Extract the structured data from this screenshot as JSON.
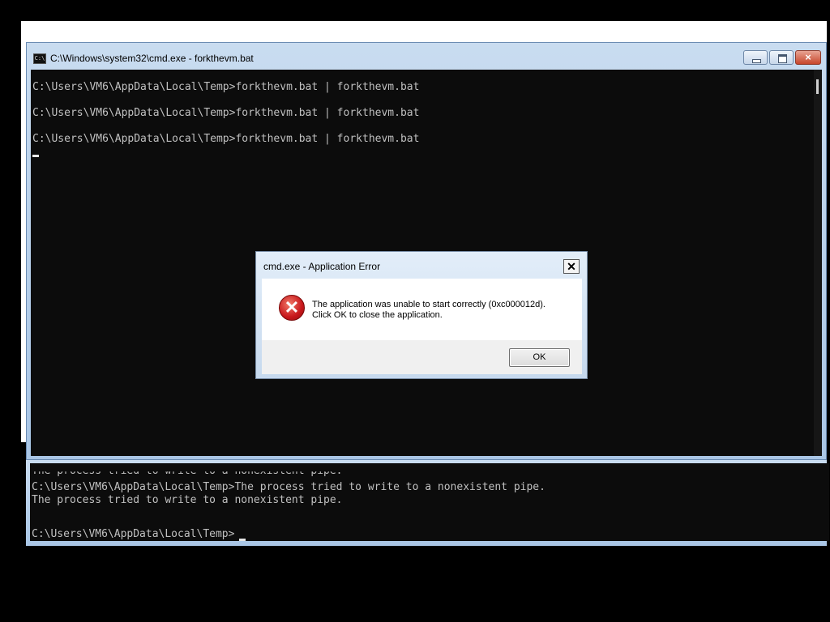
{
  "window": {
    "title": "C:\\Windows\\system32\\cmd.exe - forkthevm.bat",
    "icon": "cmd-icon",
    "icon_text": "C:\\",
    "controls": {
      "minimize": "minimize-icon",
      "maximize": "maximize-icon",
      "close": "×"
    }
  },
  "console": {
    "lines": [
      "C:\\Users\\VM6\\AppData\\Local\\Temp>forkthevm.bat | forkthevm.bat",
      "C:\\Users\\VM6\\AppData\\Local\\Temp>forkthevm.bat | forkthevm.bat",
      "C:\\Users\\VM6\\AppData\\Local\\Temp>forkthevm.bat | forkthevm.bat"
    ]
  },
  "console2": {
    "lines": [
      "The process tried to write to a nonexistent pipe.",
      "C:\\Users\\VM6\\AppData\\Local\\Temp>The process tried to write to a nonexistent pipe.",
      "The process tried to write to a nonexistent pipe.",
      "C:\\Users\\VM6\\AppData\\Local\\Temp>"
    ]
  },
  "dialog": {
    "title": "cmd.exe - Application Error",
    "close": "✕",
    "icon": "error-icon",
    "icon_glyph": "✕",
    "message_line1": "The application was unable to start correctly (0xc000012d).",
    "message_line2": "Click OK to close the application.",
    "ok_label": "OK"
  },
  "colors": {
    "console_bg": "#0c0c0c",
    "console_text": "#c0c0c0",
    "title_bar": "#b9d1ea",
    "error_red": "#c8171b"
  }
}
